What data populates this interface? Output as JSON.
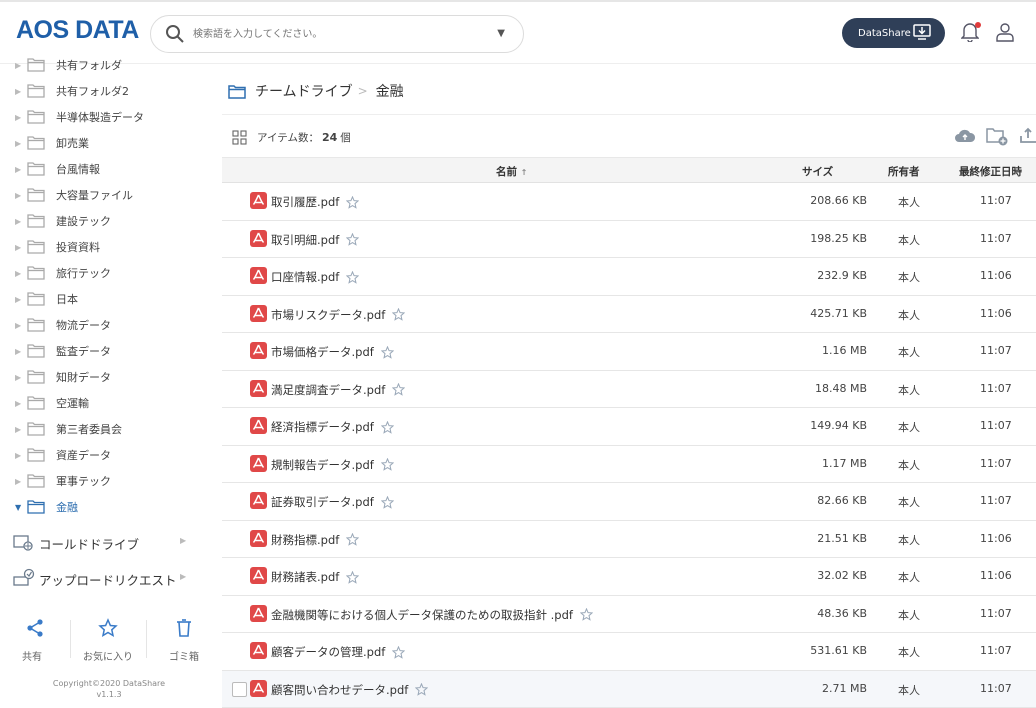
{
  "header": {
    "logo": "AOS DATA",
    "search_placeholder": "検索語を入力してください。",
    "datashare_label": "DataShare"
  },
  "sidebar": {
    "folders": [
      {
        "label": "共有フォルダ"
      },
      {
        "label": "共有フォルダ2"
      },
      {
        "label": "半導体製造データ"
      },
      {
        "label": "卸売業"
      },
      {
        "label": "台風情報"
      },
      {
        "label": "大容量ファイル"
      },
      {
        "label": "建設テック"
      },
      {
        "label": "投資資料"
      },
      {
        "label": "旅行テック"
      },
      {
        "label": "日本"
      },
      {
        "label": "物流データ"
      },
      {
        "label": "監査データ"
      },
      {
        "label": "知財データ"
      },
      {
        "label": "空運輸"
      },
      {
        "label": "第三者委員会"
      },
      {
        "label": "資産データ"
      },
      {
        "label": "軍事テック"
      },
      {
        "label": "金融"
      }
    ],
    "cold_drive": "コールドドライブ",
    "upload_request": "アップロードリクエスト",
    "actions": {
      "share": "共有",
      "favorites": "お気に入り",
      "trash": "ゴミ箱"
    },
    "copyright": "Copyright©2020 DataShare",
    "version": "v1.1.3"
  },
  "breadcrumb": {
    "root": "チームドライブ",
    "current": "金融"
  },
  "item_count": {
    "label": "アイテム数：",
    "value": "24",
    "unit": "個"
  },
  "table": {
    "headers": {
      "name": "名前",
      "sort_indicator": "↑",
      "size": "サイズ",
      "owner": "所有者",
      "modified": "最終修正日時"
    },
    "rows": [
      {
        "name": "取引履歴.pdf",
        "size": "208.66 KB",
        "owner": "本人",
        "modified": "11:07"
      },
      {
        "name": "取引明細.pdf",
        "size": "198.25 KB",
        "owner": "本人",
        "modified": "11:07"
      },
      {
        "name": "口座情報.pdf",
        "size": "232.9 KB",
        "owner": "本人",
        "modified": "11:06"
      },
      {
        "name": "市場リスクデータ.pdf",
        "size": "425.71 KB",
        "owner": "本人",
        "modified": "11:06"
      },
      {
        "name": "市場価格データ.pdf",
        "size": "1.16 MB",
        "owner": "本人",
        "modified": "11:07"
      },
      {
        "name": "満足度調査データ.pdf",
        "size": "18.48 MB",
        "owner": "本人",
        "modified": "11:07"
      },
      {
        "name": "経済指標データ.pdf",
        "size": "149.94 KB",
        "owner": "本人",
        "modified": "11:07"
      },
      {
        "name": "規制報告データ.pdf",
        "size": "1.17 MB",
        "owner": "本人",
        "modified": "11:07"
      },
      {
        "name": "証券取引データ.pdf",
        "size": "82.66 KB",
        "owner": "本人",
        "modified": "11:07"
      },
      {
        "name": "財務指標.pdf",
        "size": "21.51 KB",
        "owner": "本人",
        "modified": "11:06"
      },
      {
        "name": "財務諸表.pdf",
        "size": "32.02 KB",
        "owner": "本人",
        "modified": "11:06"
      },
      {
        "name": "金融機関等における個人データ保護のための取扱指針 .pdf",
        "size": "48.36 KB",
        "owner": "本人",
        "modified": "11:07"
      },
      {
        "name": "顧客データの管理.pdf",
        "size": "531.61 KB",
        "owner": "本人",
        "modified": "11:07"
      },
      {
        "name": "顧客問い合わせデータ.pdf",
        "size": "2.71 MB",
        "owner": "本人",
        "modified": "11:07"
      }
    ]
  }
}
